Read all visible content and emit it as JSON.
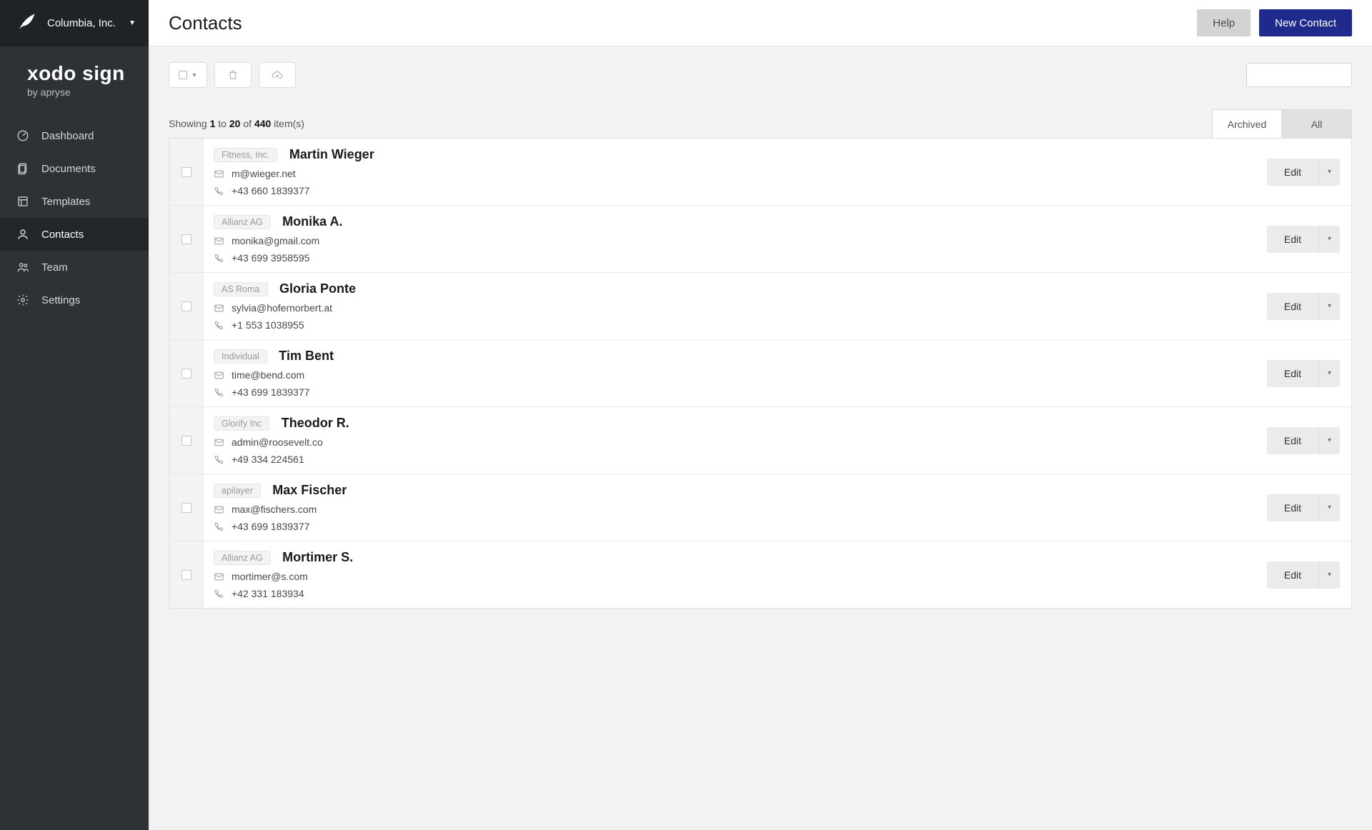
{
  "org": {
    "name": "Columbia, Inc."
  },
  "brand": {
    "title": "xodo sign",
    "sub": "by apryse"
  },
  "nav": {
    "dashboard": "Dashboard",
    "documents": "Documents",
    "templates": "Templates",
    "contacts": "Contacts",
    "team": "Team",
    "settings": "Settings"
  },
  "header": {
    "title": "Contacts",
    "help": "Help",
    "new_contact": "New Contact"
  },
  "showing": {
    "prefix": "Showing",
    "from": "1",
    "to_word": "to",
    "to": "20",
    "of_word": "of",
    "total": "440",
    "suffix": "item(s)"
  },
  "filters": {
    "archived": "Archived",
    "all": "All"
  },
  "actions": {
    "edit": "Edit"
  },
  "contacts": [
    {
      "tag": "Fitness, Inc.",
      "name": "Martin Wieger",
      "email": "m@wieger.net",
      "phone": "+43 660 1839377"
    },
    {
      "tag": "Allianz AG",
      "name": "Monika A.",
      "email": "monika@gmail.com",
      "phone": "+43 699 3958595"
    },
    {
      "tag": "AS Roma",
      "name": "Gloria Ponte",
      "email": "sylvia@hofernorbert.at",
      "phone": "+1 553 1038955"
    },
    {
      "tag": "Individual",
      "name": "Tim Bent",
      "email": "time@bend.com",
      "phone": "+43 699 1839377"
    },
    {
      "tag": "Glorify Inc",
      "name": "Theodor R.",
      "email": "admin@roosevelt.co",
      "phone": "+49 334 224561"
    },
    {
      "tag": "apilayer",
      "name": "Max Fischer",
      "email": "max@fischers.com",
      "phone": "+43 699 1839377"
    },
    {
      "tag": "Allianz AG",
      "name": "Mortimer S.",
      "email": "mortimer@s.com",
      "phone": "+42 331 183934"
    }
  ],
  "chart_data": {
    "type": "table"
  }
}
